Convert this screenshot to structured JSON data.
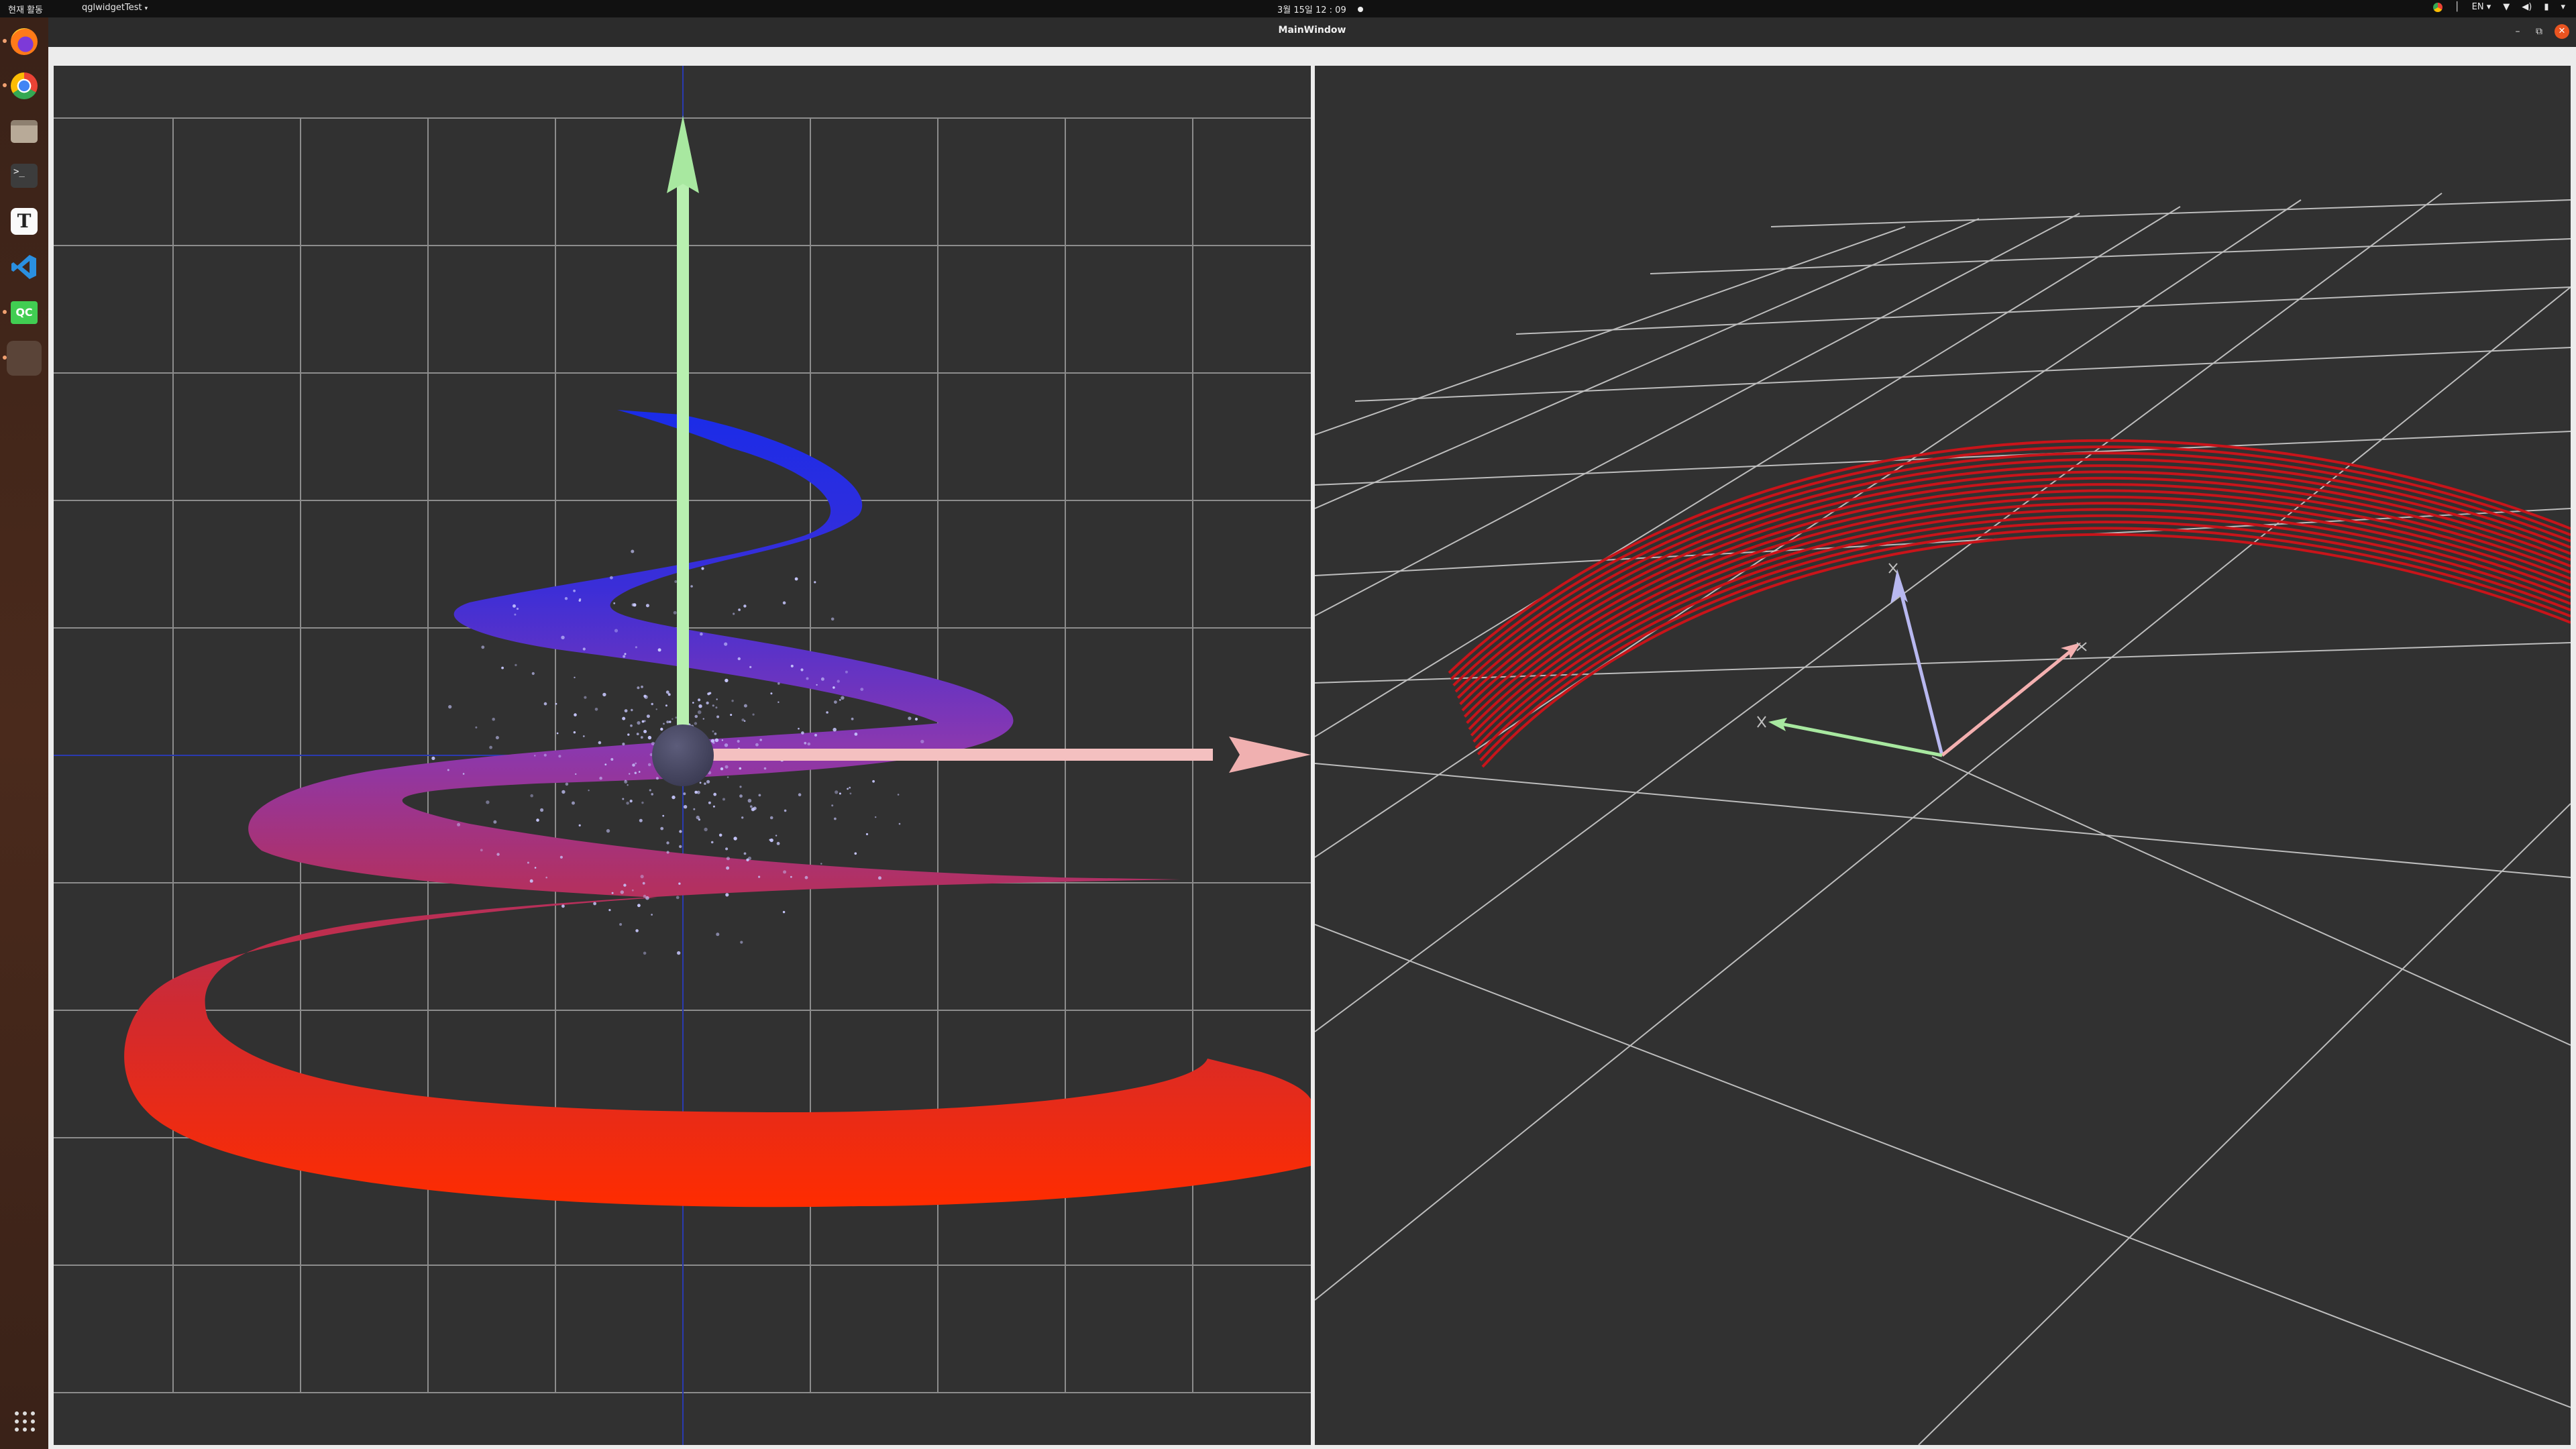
{
  "topbar": {
    "activities": "현재 활동",
    "app_menu": "qglwidgetTest",
    "clock": "3월 15일  12 : 09",
    "language": "EN"
  },
  "dock": {
    "items": [
      {
        "name": "firefox",
        "running": true
      },
      {
        "name": "chrome",
        "running": true
      },
      {
        "name": "files",
        "running": false
      },
      {
        "name": "terminal",
        "running": false
      },
      {
        "name": "text-editor",
        "running": false
      },
      {
        "name": "vscode",
        "running": false
      },
      {
        "name": "qt-creator",
        "running": true
      },
      {
        "name": "qglwidgettest",
        "running": true
      }
    ]
  },
  "window": {
    "title": "MainWindow",
    "minimize_symbol": "–",
    "maximize_symbol": "⧉",
    "close_symbol": "✕"
  },
  "scene_left": {
    "description_colors": {
      "spiral_top": "#1e2ee0",
      "spiral_mid": "#8a3aa8",
      "spiral_bottom": "#ff2a00",
      "y_axis_arrow": "#b8f0b0",
      "x_axis_arrow": "#f4b8b8",
      "sphere": "#4a4a66",
      "grid": "#9a9a9a"
    }
  },
  "scene_right": {
    "description_colors": {
      "band": "#c8141a",
      "z_axis": "#b8b8f0",
      "x_axis": "#f4b0b0",
      "y_axis": "#a8e8a0",
      "grid": "#bdbdbd"
    }
  }
}
